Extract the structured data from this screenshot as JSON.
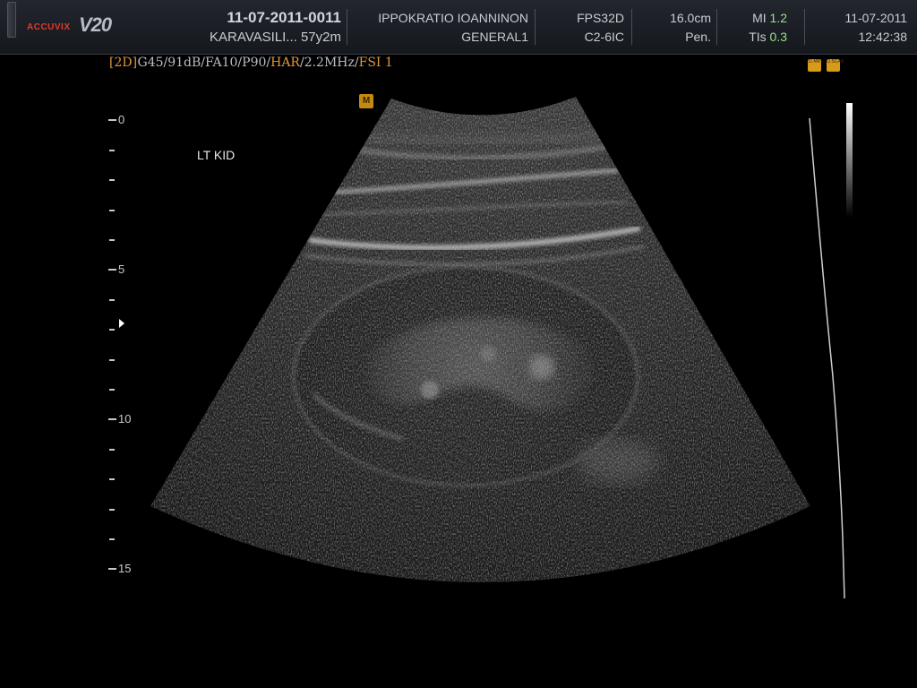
{
  "header": {
    "brand": "ACCUVIX",
    "model": "V20",
    "patient_id": "11-07-2011-0011",
    "patient_name_age": "KARAVASILI... 57y2m",
    "institution": "IPPOKRATIO IOANNINON",
    "preset": "GENERAL1",
    "probe_setting": "FPS32D",
    "probe": "C2-6IC",
    "depth": "16.0cm",
    "mode": "Pen.",
    "mi_label": "MI",
    "mi_value": "1.2",
    "tis_label": "TIs",
    "tis_value": "0.3",
    "date": "11-07-2011",
    "time": "12:42:38"
  },
  "params": {
    "mode_bracket": "[2D]",
    "gain_string": "G45/91dB/FA10/P90/",
    "har": "HAR",
    "slash": "/",
    "freq": "2.2MHz",
    "slash2": "/",
    "fsi": "FSI 1"
  },
  "badges": [
    "D.MR",
    "Q.SCAN"
  ],
  "marker_label": "M",
  "annotation": "LT KID",
  "depth_scale": {
    "labels": [
      "0",
      "5",
      "10",
      "15"
    ],
    "unit": "cm",
    "max": 15
  },
  "colors": {
    "accent_orange": "#e0953a",
    "value_green": "#9be28a",
    "brand_red": "#e23a2a"
  },
  "icons": [
    "focus-marker-icon",
    "m-marker-icon"
  ]
}
